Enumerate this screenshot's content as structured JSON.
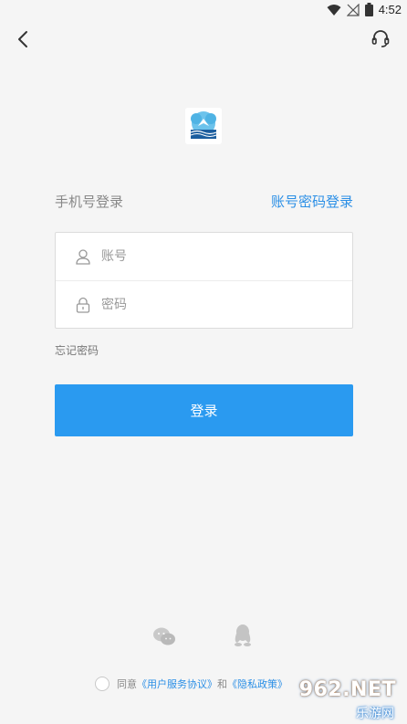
{
  "status_bar": {
    "time": "4:52"
  },
  "header": {
    "back_icon": "chevron-left-icon",
    "support_icon": "headset-icon"
  },
  "logo": {
    "icon": "app-logo"
  },
  "login_mode": {
    "title": "手机号登录",
    "switch_label": "账号密码登录"
  },
  "form": {
    "account_placeholder": "账号",
    "password_placeholder": "密码",
    "account_value": "",
    "password_value": ""
  },
  "forgot_label": "忘记密码",
  "login_button_label": "登录",
  "social": {
    "wechat_icon": "wechat-icon",
    "qq_icon": "qq-icon"
  },
  "agreement": {
    "prefix": "同意",
    "terms_link": "《用户服务协议》",
    "conjunction": "和",
    "privacy_link": "《隐私政策》"
  },
  "watermark": {
    "top": "962.NET",
    "bottom": "乐游网"
  },
  "colors": {
    "accent": "#2a9af0",
    "link": "#2b8fe6",
    "background": "#f5f5f5"
  }
}
